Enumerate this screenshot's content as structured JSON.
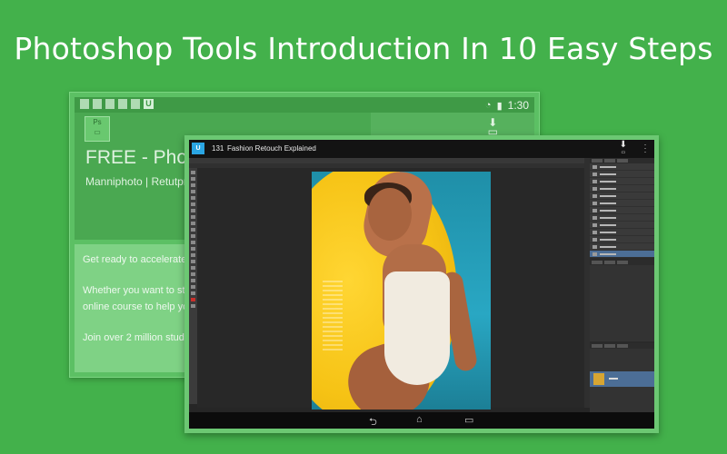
{
  "headline": "Photoshop Tools Introduction In 10 Easy Steps",
  "back_screen": {
    "status_time": "1:30",
    "status_u": "U",
    "app_title": "FREE - Photos",
    "app_subtitle": "Manniphoto  | Retutpro",
    "description_lines": [
      "Get ready to accelerate you",
      "Whether you want to start a",
      "online course to help you g",
      "Join over 2 million students"
    ]
  },
  "front_screen": {
    "video_number": "131",
    "video_title": "Fashion Retouch Explained",
    "history_items": 13,
    "nav": {
      "back": "back",
      "home": "home",
      "recent": "recent"
    }
  },
  "colors": {
    "background": "#43b14b",
    "accent": "#2aa5e3",
    "selection": "#4c6e96"
  }
}
